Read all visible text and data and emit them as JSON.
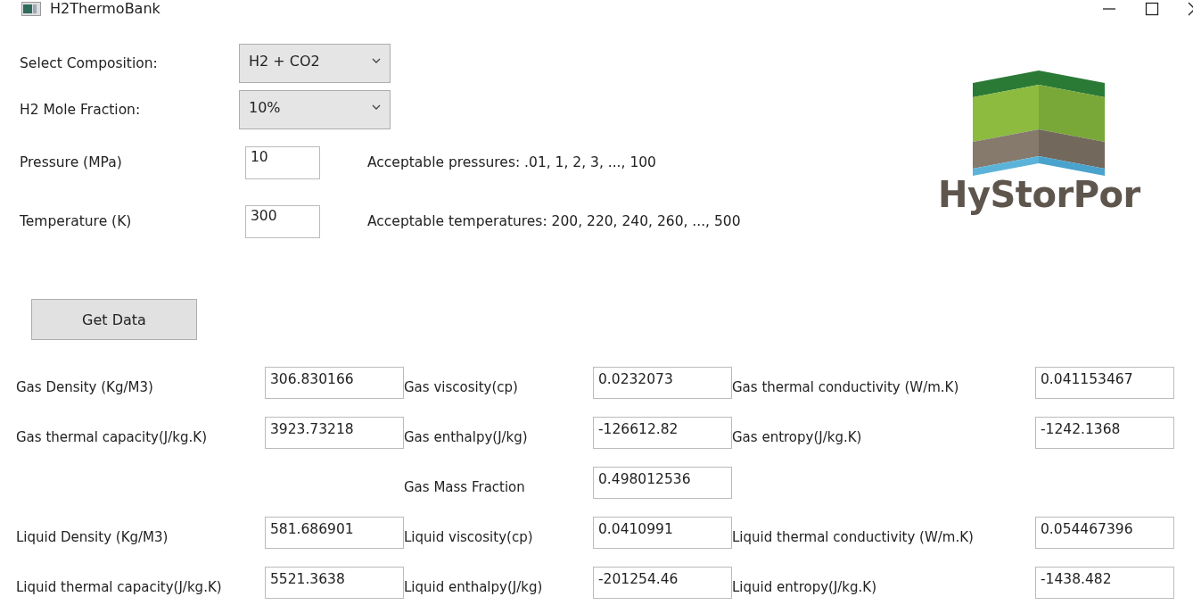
{
  "window": {
    "title": "H2ThermoBank"
  },
  "inputs": [
    {
      "kind": "select",
      "label": "Select Composition:",
      "value": "H2 + CO2"
    },
    {
      "kind": "select",
      "label": "H2 Mole Fraction:",
      "value": "10%"
    },
    {
      "kind": "text",
      "label": "Pressure (MPa)",
      "value": "10",
      "hint": "Acceptable pressures: .01, 1, 2, 3, ..., 100"
    },
    {
      "kind": "text",
      "label": "Temperature (K)",
      "value": "300",
      "hint": "Acceptable temperatures: 200, 220, 240, 260, ..., 500"
    }
  ],
  "logo": {
    "text": "HyStorPor"
  },
  "get_data_button": "Get Data",
  "results": [
    {
      "left": {
        "label": "Gas Density (Kg/M3)",
        "value": "306.830166"
      },
      "middle": {
        "label": "Gas viscosity(cp)",
        "value": "0.0232073"
      },
      "right": {
        "label": "Gas thermal conductivity  (W/m.K)",
        "value": "0.041153467"
      }
    },
    {
      "left": {
        "label": "Gas thermal capacity(J/kg.K)",
        "value": "3923.73218"
      },
      "middle": {
        "label": "Gas enthalpy(J/kg)",
        "value": "-126612.82"
      },
      "right": {
        "label": "Gas entropy(J/kg.K)",
        "value": "-1242.1368"
      }
    },
    {
      "middle": {
        "label": "Gas Mass Fraction",
        "value": "0.498012536"
      }
    },
    {
      "left": {
        "label": "Liquid Density (Kg/M3)",
        "value": "581.686901"
      },
      "middle": {
        "label": "Liquid viscosity(cp)",
        "value": "0.0410991"
      },
      "right": {
        "label": "Liquid thermal conductivity  (W/m.K)",
        "value": "0.054467396"
      }
    },
    {
      "left": {
        "label": "Liquid thermal capacity(J/kg.K)",
        "value": "5521.3638"
      },
      "middle": {
        "label": "Liquid enthalpy(J/kg)",
        "value": "-201254.46"
      },
      "right": {
        "label": "Liquid entropy(J/kg.K)",
        "value": "-1438.482"
      }
    }
  ]
}
